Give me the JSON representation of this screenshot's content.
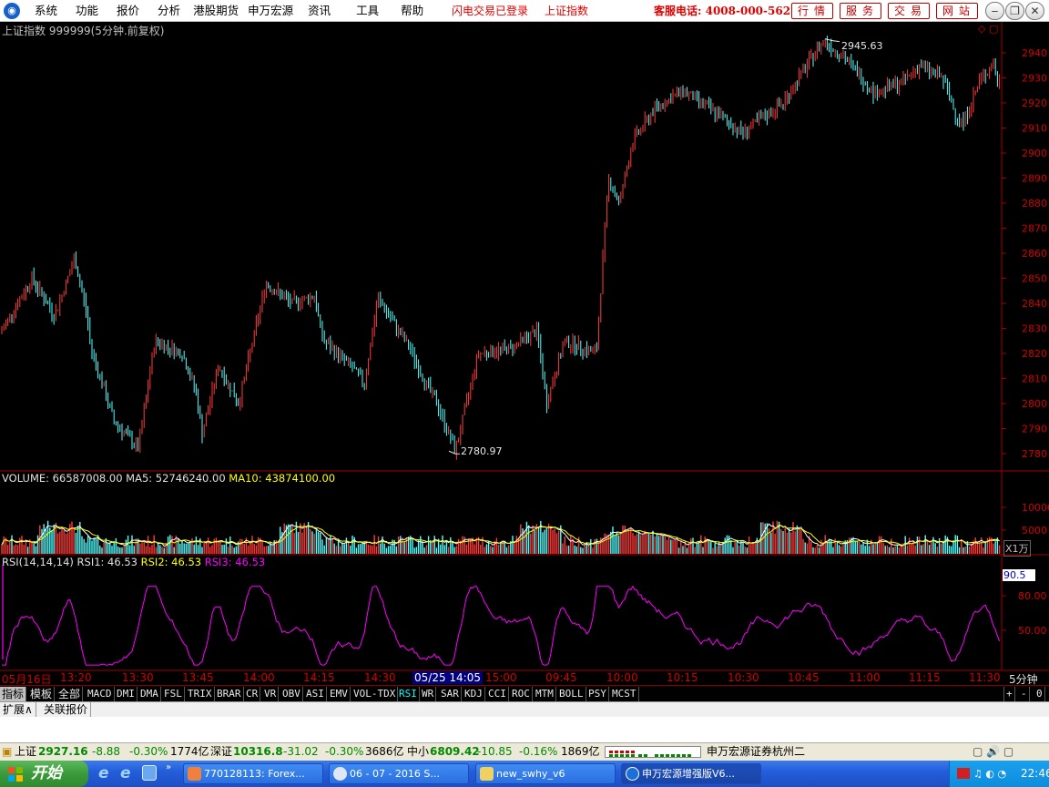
{
  "menu": {
    "items": [
      "系统",
      "功能",
      "报价",
      "分析",
      "港股期货",
      "申万宏源",
      "资讯",
      "工具",
      "帮助"
    ],
    "notice_login": "闪电交易已登录",
    "notice_index": "上证指数",
    "phone": "客服电话: 4008-000-562",
    "top_buttons": [
      "行情",
      "服务",
      "交易",
      "网站"
    ]
  },
  "chart": {
    "header": "上证指数 999999(5分钟.前复权)",
    "price_high_label": "2945.63",
    "price_low_label": "2780.97",
    "y_ticks": [
      "2940",
      "2930",
      "2920",
      "2910",
      "2900",
      "2890",
      "2880",
      "2870",
      "2860",
      "2850",
      "2840",
      "2830",
      "2820",
      "2810",
      "2800",
      "2790",
      "2780"
    ],
    "volume_header": {
      "volume": "VOLUME: 66587008.00",
      "ma5": "MA5: 52746240.00",
      "ma10": "MA10: 43874100.00"
    },
    "volume_ticks": [
      "10000",
      "5000"
    ],
    "volume_unit": "X1万",
    "rsi_header": {
      "name": "RSI(14,14,14)",
      "rsi1": "RSI1: 46.53",
      "rsi2": "RSI2: 46.53",
      "rsi3": "RSI3: 46.53"
    },
    "rsi_box": "90.5",
    "rsi_ticks": [
      "80.00",
      "50.00"
    ],
    "time_axis": [
      "05月16日",
      "13:20",
      "13:30",
      "13:45",
      "14:00",
      "14:15",
      "14:30",
      "05/25 14:05",
      "15:00",
      "09:45",
      "10:00",
      "10:15",
      "10:30",
      "10:45",
      "11:00",
      "11:15",
      "11:30"
    ],
    "period": "5分钟"
  },
  "tabs": [
    "指标",
    "模板",
    "全部",
    "MACD",
    "DMI",
    "DMA",
    "FSL",
    "TRIX",
    "BRAR",
    "CR",
    "VR",
    "OBV",
    "ASI",
    "EMV",
    "VOL-TDX",
    "RSI",
    "WR",
    "SAR",
    "KDJ",
    "CCI",
    "ROC",
    "MTM",
    "BOLL",
    "PSY",
    "MCST"
  ],
  "tab_controls": [
    "+",
    "-",
    "0"
  ],
  "ext": [
    "扩展∧",
    "关联报价"
  ],
  "status": {
    "sh_name": "上证",
    "sh_val": "2927.16",
    "sh_chg": "-8.88",
    "sh_pct": "-0.30%",
    "sh_amt": "1774亿",
    "sz_name": "深证",
    "sz_val": "10316.8",
    "sz_chg": "-31.02",
    "sz_pct": "-0.30%",
    "sz_amt": "3686亿",
    "zx_name": "中小",
    "zx_val": "6809.42",
    "zx_chg": "-10.85",
    "zx_pct": "-0.16%",
    "zx_amt": "1869亿",
    "broker": "申万宏源证券杭州二"
  },
  "taskbar": {
    "start": "开始",
    "tasks": [
      "770128113: Forex...",
      "06 - 07 - 2016 S...",
      "new_swhy_v6",
      "申万宏源增强版V6..."
    ],
    "clock": "22:46"
  }
}
